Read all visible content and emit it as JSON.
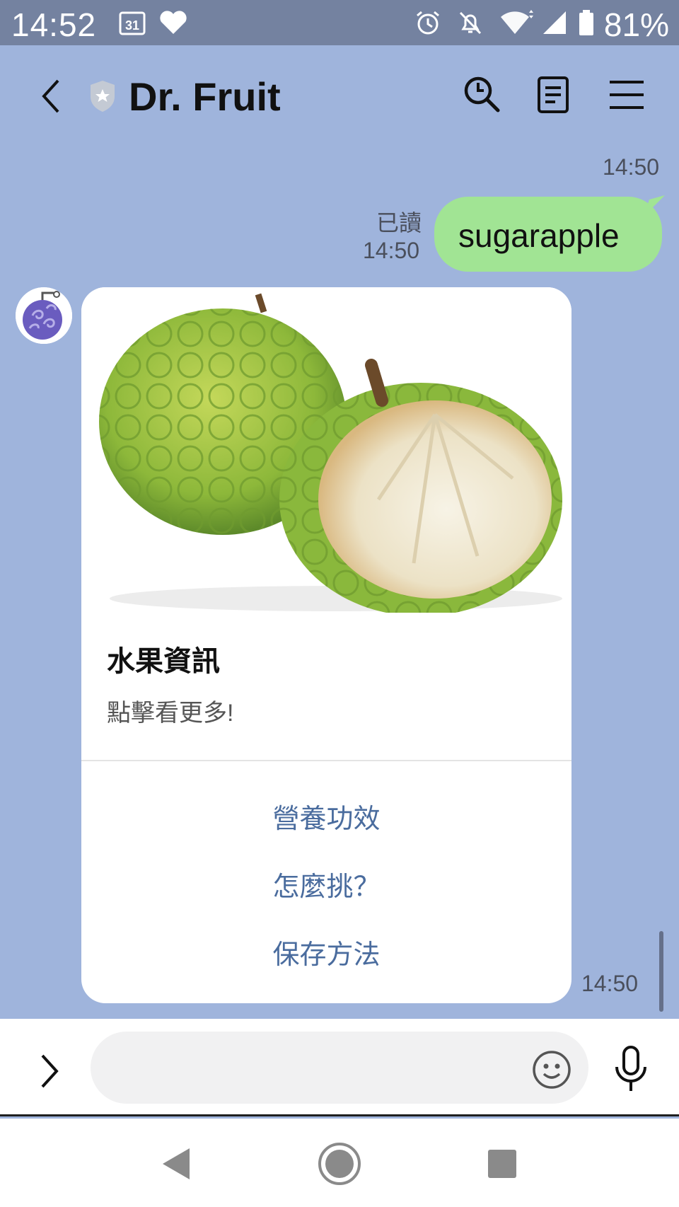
{
  "status_bar": {
    "time": "14:52",
    "calendar_day": "31",
    "battery_percent": "81%"
  },
  "header": {
    "title": "Dr. Fruit"
  },
  "messages": {
    "sent": {
      "timestamp_top": "14:50",
      "read_label": "已讀",
      "read_time": "14:50",
      "text": "sugarapple"
    },
    "received": {
      "card_title": "水果資訊",
      "card_subtitle": "點擊看更多!",
      "actions": [
        "營養功效",
        "怎麼挑？",
        "保存方法"
      ],
      "timestamp": "14:50"
    }
  },
  "input": {
    "placeholder": ""
  },
  "colors": {
    "chat_background": "#9fb4dc",
    "sent_bubble": "#a1e494",
    "action_link": "#4a6c9e",
    "status_bar": "#7482a0"
  }
}
